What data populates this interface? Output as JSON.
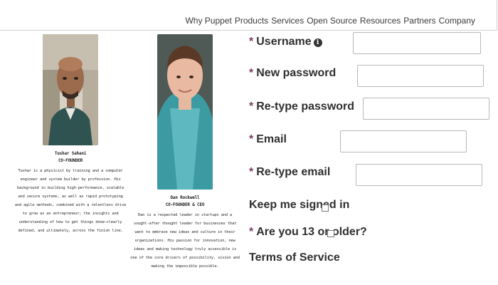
{
  "nav": {
    "links": [
      "Why Puppet",
      "Products",
      "Services",
      "Open Source",
      "Resources",
      "Partners",
      "Company"
    ]
  },
  "bios": [
    {
      "name": "Tushar Sahani",
      "role": "CO-FOUNDER",
      "desc": "Tushar is a physicist by training and a computer engineer and system builder by profession. His background in building high-performance, scalable and secure systems, as well as rapid prototyping and agile methods, combined with a relentless drive to grow as an entrepreneur; the insights and understanding of how to get things done—clearly defined, and ultimately, across the finish line."
    },
    {
      "name": "Dan Rockwell",
      "role": "CO-FOUNDER & CEO",
      "desc": "Dan is a respected leader in startups and a sought-after thought leader for businesses that want to embrace new ideas and culture in their organizations. His passion for innovation, new ideas and making technology truly accessible is one of the core drivers of possibility, vision and making the impossible possible."
    }
  ],
  "form": {
    "fields": [
      {
        "label": "Username",
        "value": "",
        "info_icon": "info-icon"
      },
      {
        "label": "New password",
        "value": ""
      },
      {
        "label": "Re-type password",
        "value": ""
      },
      {
        "label": "Email",
        "value": ""
      },
      {
        "label": "Re-type email",
        "value": ""
      }
    ],
    "keep_signed_in": "Keep me signed in",
    "age_question": "Are you 13 or older?",
    "terms_heading": "Terms of Service",
    "required_mark": "*"
  },
  "colors": {
    "required_mark": "#7b3d63",
    "input_border": "#b8b8b8",
    "nav_border": "#cfcfcf"
  }
}
